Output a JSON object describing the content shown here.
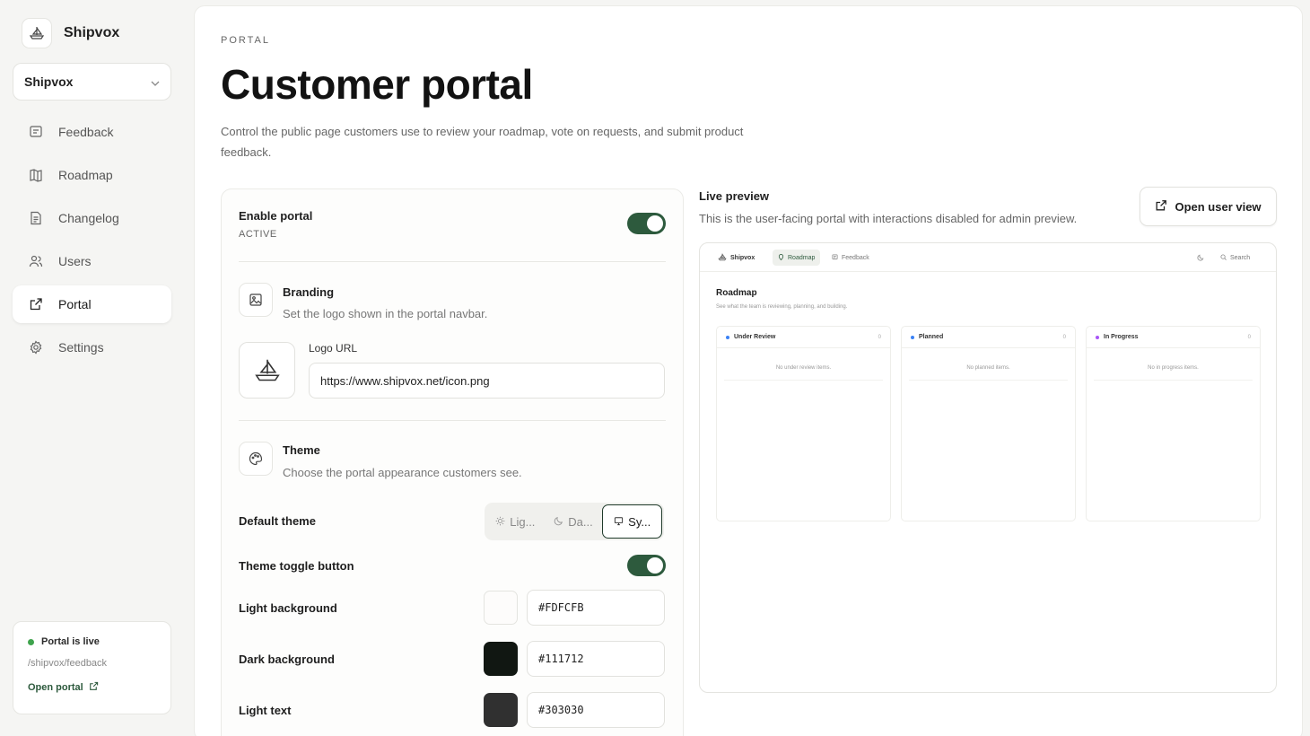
{
  "brand": {
    "name": "Shipvox"
  },
  "workspace": {
    "selected": "Shipvox"
  },
  "nav": [
    {
      "label": "Feedback",
      "icon": "feedback-icon"
    },
    {
      "label": "Roadmap",
      "icon": "map-icon"
    },
    {
      "label": "Changelog",
      "icon": "document-icon"
    },
    {
      "label": "Users",
      "icon": "users-icon"
    },
    {
      "label": "Portal",
      "icon": "external-link-icon",
      "active": true
    },
    {
      "label": "Settings",
      "icon": "gear-icon"
    }
  ],
  "status": {
    "label": "Portal is live",
    "path": "/shipvox/feedback",
    "link": "Open portal"
  },
  "page": {
    "eyebrow": "PORTAL",
    "title": "Customer portal",
    "description": "Control the public page customers use to review your roadmap, vote on requests, and submit product feedback."
  },
  "settings": {
    "enable": {
      "label": "Enable portal",
      "status": "ACTIVE",
      "on": true
    },
    "branding": {
      "title": "Branding",
      "desc": "Set the logo shown in the portal navbar.",
      "logo_label": "Logo URL",
      "logo_url": "https://www.shipvox.net/icon.png"
    },
    "theme": {
      "title": "Theme",
      "desc": "Choose the portal appearance customers see.",
      "default_label": "Default theme",
      "options": [
        "Lig...",
        "Da...",
        "Sy..."
      ],
      "selected": "Sy...",
      "toggle_label": "Theme toggle button",
      "toggle_on": true
    },
    "colors": [
      {
        "label": "Light background",
        "value": "#FDFCFB"
      },
      {
        "label": "Dark background",
        "value": "#111712"
      },
      {
        "label": "Light text",
        "value": "#303030"
      }
    ]
  },
  "preview": {
    "title": "Live preview",
    "desc": "This is the user-facing portal with interactions disabled for admin preview.",
    "open_button": "Open user view",
    "nav": {
      "brand": "Shipvox",
      "roadmap": "Roadmap",
      "feedback": "Feedback",
      "search": "Search"
    },
    "heading": "Roadmap",
    "subheading": "See what the team is reviewing, planning, and building.",
    "columns": [
      {
        "name": "Under Review",
        "count": "0",
        "empty": "No under review items.",
        "color": "#3b82f6"
      },
      {
        "name": "Planned",
        "count": "0",
        "empty": "No planned items.",
        "color": "#3b82f6"
      },
      {
        "name": "In Progress",
        "count": "0",
        "empty": "No in progress items.",
        "color": "#a855f7"
      }
    ]
  }
}
